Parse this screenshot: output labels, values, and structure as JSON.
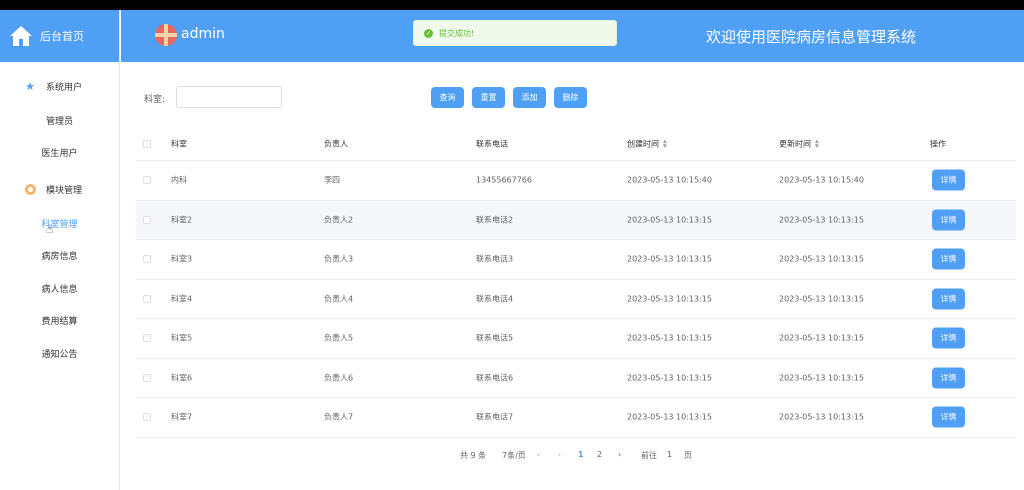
{
  "sidebar": {
    "home_title": "后台首页",
    "groups": [
      {
        "label": "系统用户",
        "icon": "star-icon",
        "items": [
          "管理员",
          "医生用户"
        ]
      },
      {
        "label": "模块管理",
        "icon": "gear-icon",
        "items": [
          "科室管理",
          "病房信息",
          "病人信息",
          "费用结算",
          "通知公告"
        ]
      }
    ],
    "active_item": "科室管理"
  },
  "header": {
    "username": "admin",
    "system_title": "欢迎使用医院病房信息管理系统",
    "toast_message": "提交成功!"
  },
  "search": {
    "label": "科室:",
    "value": "",
    "buttons": {
      "query": "查询",
      "reset": "重置",
      "add": "添加",
      "delete": "删除"
    }
  },
  "table": {
    "columns": [
      "科室",
      "负责人",
      "联系电话",
      "创建时间",
      "更新时间",
      "操作"
    ],
    "detail_label": "详情",
    "rows": [
      {
        "dept": "内科",
        "leader": "李四",
        "phone": "13455667766",
        "created": "2023-05-13 10:15:40",
        "updated": "2023-05-13 10:15:40"
      },
      {
        "dept": "科室2",
        "leader": "负责人2",
        "phone": "联系电话2",
        "created": "2023-05-13 10:13:15",
        "updated": "2023-05-13 10:13:15"
      },
      {
        "dept": "科室3",
        "leader": "负责人3",
        "phone": "联系电话3",
        "created": "2023-05-13 10:13:15",
        "updated": "2023-05-13 10:13:15"
      },
      {
        "dept": "科室4",
        "leader": "负责人4",
        "phone": "联系电话4",
        "created": "2023-05-13 10:13:15",
        "updated": "2023-05-13 10:13:15"
      },
      {
        "dept": "科室5",
        "leader": "负责人5",
        "phone": "联系电话5",
        "created": "2023-05-13 10:13:15",
        "updated": "2023-05-13 10:13:15"
      },
      {
        "dept": "科室6",
        "leader": "负责人6",
        "phone": "联系电话6",
        "created": "2023-05-13 10:13:15",
        "updated": "2023-05-13 10:13:15"
      },
      {
        "dept": "科室7",
        "leader": "负责人7",
        "phone": "联系电话7",
        "created": "2023-05-13 10:13:15",
        "updated": "2023-05-13 10:13:15"
      }
    ]
  },
  "pagination": {
    "total": "共 9 条",
    "page_size": "7条/页",
    "prev": "«",
    "prev_one": "‹",
    "pages": [
      "1",
      "2"
    ],
    "next": "›",
    "goto_label": "前往",
    "goto_value": "1",
    "page_unit": "页"
  }
}
